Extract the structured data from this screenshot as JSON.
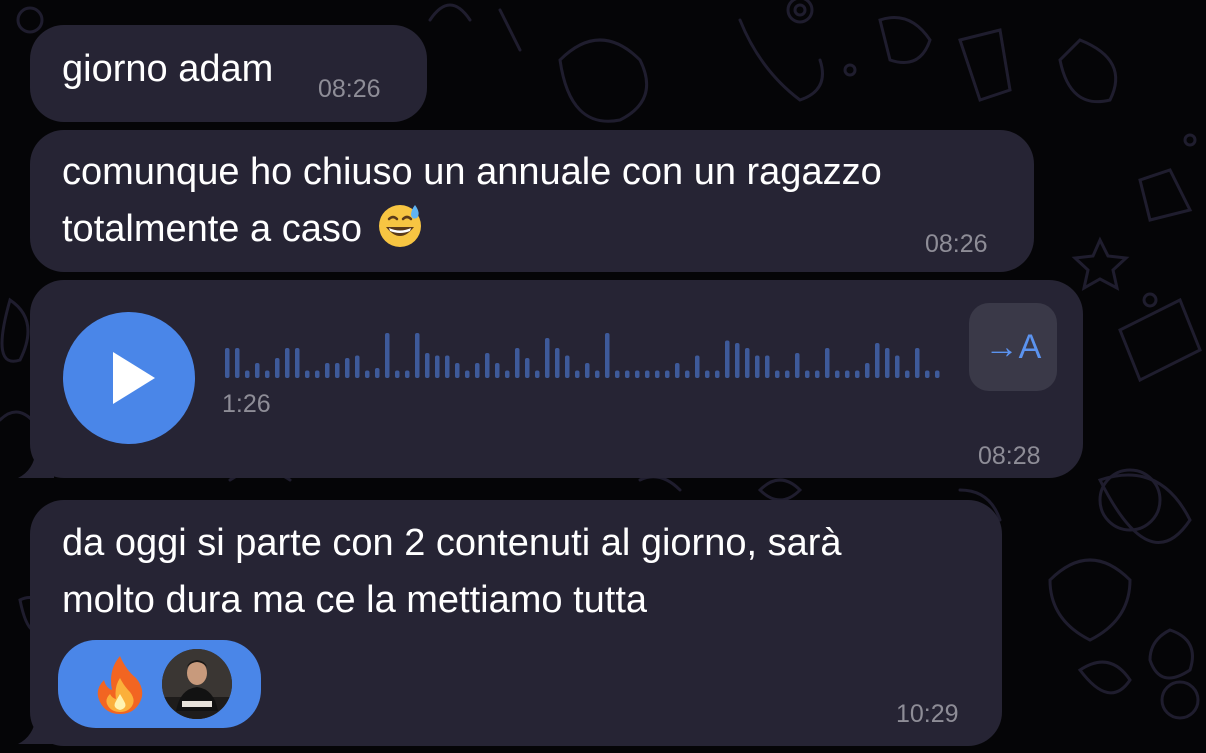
{
  "messages": [
    {
      "text": "giorno adam",
      "time": "08:26"
    },
    {
      "line1": "comunque ho chiuso un annuale con un ragazzo",
      "line2": "totalmente a caso",
      "emoji": "grinning-sweat-emoji",
      "time": "08:26"
    },
    {
      "type": "voice",
      "duration": "1:26",
      "transcribe_label": "→A",
      "time": "08:28"
    },
    {
      "line1": "da oggi si parte con 2 contenuti al giorno, sarà",
      "line2": "molto dura ma ce la mettiamo tutta",
      "time": "10:29",
      "reactions": {
        "emoji": "fire-emoji",
        "reactor": "avatar"
      }
    }
  ],
  "colors": {
    "background": "#050507",
    "bubble": "#262434",
    "accent": "#4a86e8",
    "waveform": "#3e5a9a",
    "timestamp": "#8e8d97",
    "doodle": "#1f1d2e"
  }
}
